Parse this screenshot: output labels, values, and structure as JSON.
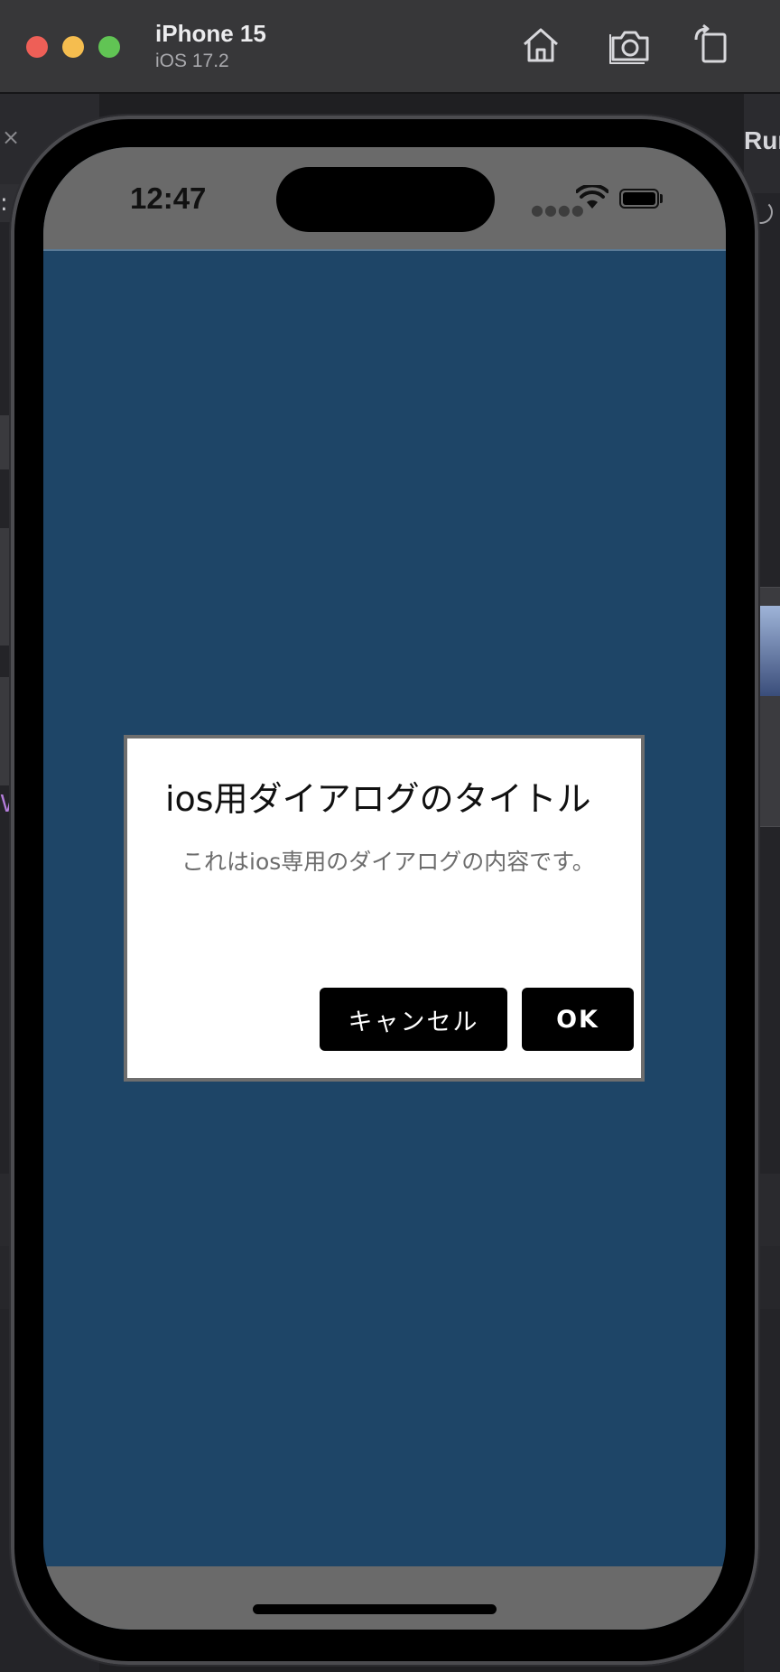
{
  "simulator": {
    "device_name": "iPhone 15",
    "os_version": "iOS 17.2",
    "toolbar_icons": [
      "home-icon",
      "screenshot-icon",
      "rotate-icon"
    ]
  },
  "background": {
    "right_panel_label": "Run",
    "left_editor_fragment": "V"
  },
  "status_bar": {
    "time": "12:47",
    "icons": [
      "cellular-signal-icon",
      "wifi-icon",
      "battery-icon"
    ]
  },
  "screen": {
    "background_color": "#1e4567"
  },
  "dialog": {
    "title": "ios用ダイアログのタイトル",
    "message": "これはios専用のダイアログの内容です。",
    "cancel_label": "キャンセル",
    "ok_label": "OK"
  }
}
